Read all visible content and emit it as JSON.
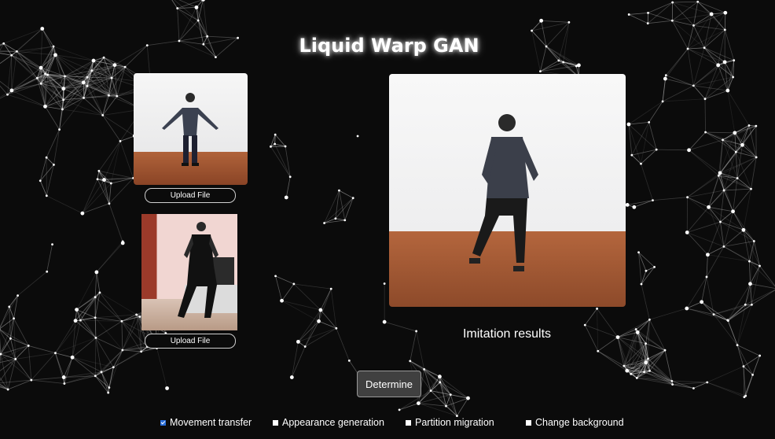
{
  "title": "Liquid Warp GAN",
  "upload_buttons": [
    "Upload File",
    "Upload File"
  ],
  "result_label": "Imitation results",
  "determine_label": "Determine",
  "options": [
    {
      "label": "Movement transfer",
      "checked": true
    },
    {
      "label": "Appearance generation",
      "checked": false
    },
    {
      "label": "Partition migration",
      "checked": false
    },
    {
      "label": "Change background",
      "checked": false
    }
  ],
  "colors": {
    "background": "#0b0b0b",
    "network": "#d0d0d0",
    "checkbox_checked": "#2a6fdb",
    "button_bg": "#404040"
  }
}
